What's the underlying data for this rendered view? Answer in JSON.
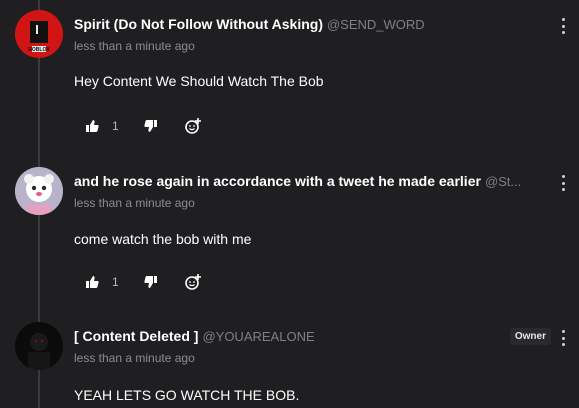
{
  "comments": [
    {
      "author": "Spirit (Do Not Follow Without Asking)",
      "handle": "@SEND_WORD",
      "timestamp": "less than a minute ago",
      "body": "Hey Content We Should Watch The Bob",
      "likes": "1",
      "avatar_label": "ROBLOX"
    },
    {
      "author": "and he rose again in accordance with a tweet he made earlier",
      "handle": "@St...",
      "timestamp": "less than a minute ago",
      "body": "come watch the bob with me",
      "likes": "1"
    },
    {
      "author": "[ Content Deleted ]",
      "handle": "@YOUAREALONE",
      "timestamp": "less than a minute ago",
      "body": "YEAH LETS GO WATCH THE BOB.",
      "badge": "Owner"
    }
  ],
  "colors": {
    "background": "#1f1f22",
    "muted_text": "#8c8c92",
    "avatar_red": "#d11414"
  },
  "icons": [
    "thumbs-up-icon",
    "thumbs-down-icon",
    "reply-icon",
    "more-options-icon"
  ]
}
